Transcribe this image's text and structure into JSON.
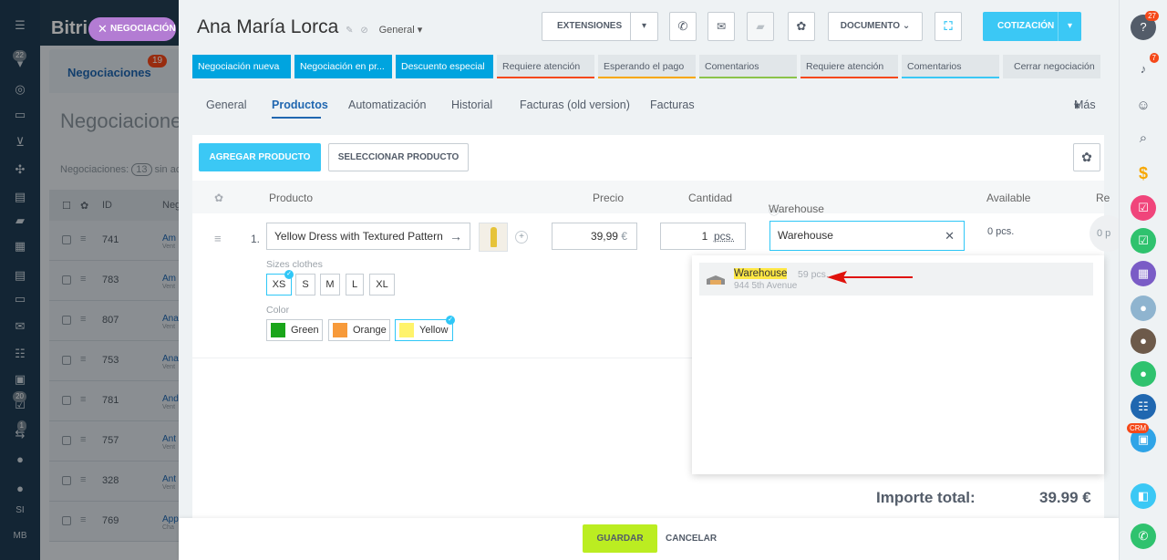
{
  "leftnav": {
    "badges": [
      "22",
      "20",
      "1"
    ],
    "bottom_labels": [
      "SI",
      "MB"
    ]
  },
  "bg": {
    "brand": "Bitri",
    "tab_label": "Negociaciones",
    "tab_badge": "19",
    "heading": "Negociaciones",
    "count_label": "Negociaciones:",
    "count_value": "13",
    "count_suffix": "sin ac",
    "col_id": "ID",
    "col_name": "Neg",
    "rows": [
      {
        "id": "741",
        "name": "Am",
        "sub": "Vent"
      },
      {
        "id": "783",
        "name": "Am",
        "sub": "Vent"
      },
      {
        "id": "807",
        "name": "Ana",
        "sub": "Vent"
      },
      {
        "id": "753",
        "name": "Ana",
        "sub": "Vent"
      },
      {
        "id": "781",
        "name": "And",
        "sub": "Vent"
      },
      {
        "id": "757",
        "name": "Ant",
        "sub": "Vent"
      },
      {
        "id": "328",
        "name": "Ant",
        "sub": "Vent"
      },
      {
        "id": "769",
        "name": "App",
        "sub": "Cha"
      }
    ]
  },
  "chip_label": "NEGOCIACIÓN",
  "header": {
    "title": "Ana María  Lorca",
    "category": "General",
    "extensiones": "EXTENSIONES",
    "documento": "DOCUMENTO",
    "cotizacion": "COTIZACIÓN"
  },
  "stages": [
    {
      "label": "Negociación nueva",
      "active": true
    },
    {
      "label": "Negociación en pr...",
      "active": true
    },
    {
      "label": "Descuento especial",
      "active": true
    },
    {
      "label": "Requiere atención",
      "active": false
    },
    {
      "label": "Esperando el pago",
      "active": false
    },
    {
      "label": "Comentarios",
      "active": false
    },
    {
      "label": "Requiere atención",
      "active": false
    },
    {
      "label": "Comentarios",
      "active": false
    },
    {
      "label": "Cerrar negociación",
      "active": false
    }
  ],
  "tabs": [
    "General",
    "Productos",
    "Automatización",
    "Historial",
    "Facturas (old version)",
    "Facturas",
    "Más"
  ],
  "products": {
    "add_button": "AGREGAR PRODUCTO",
    "select_button": "SELECCIONAR PRODUCTO",
    "columns": {
      "product": "Producto",
      "price": "Precio",
      "quantity": "Cantidad",
      "warehouse": "Warehouse",
      "available": "Available",
      "re": "Re"
    },
    "row": {
      "index": "1.",
      "name": "Yellow Dress with Textured Pattern",
      "price": "39,99",
      "currency": "€",
      "qty": "1",
      "unit": "pcs.",
      "warehouse_input": "Warehouse",
      "available": "0 pcs.",
      "reserved": "0 p"
    },
    "sizes_label": "Sizes clothes",
    "sizes": [
      "XS",
      "S",
      "M",
      "L",
      "XL"
    ],
    "color_label": "Color",
    "colors": [
      {
        "name": "Green",
        "hex": "#1aa51a"
      },
      {
        "name": "Orange",
        "hex": "#f79a3a"
      },
      {
        "name": "Yellow",
        "hex": "#fff36b"
      }
    ]
  },
  "dropdown": {
    "name": "Warehouse",
    "qty": "59 pcs.",
    "address": "944 5th Avenue"
  },
  "total": {
    "label": "Importe total:",
    "value": "39.99 €"
  },
  "footer": {
    "save": "GUARDAR",
    "cancel": "CANCELAR"
  },
  "rightbar": {
    "help_badge": "27",
    "bell_badge": "7",
    "crm_label": "CRM"
  },
  "colors": {
    "accent": "#3bc8f5",
    "stage_active": "#00a4df",
    "save_green": "#bbed21",
    "arrow_red": "#e0120c"
  }
}
